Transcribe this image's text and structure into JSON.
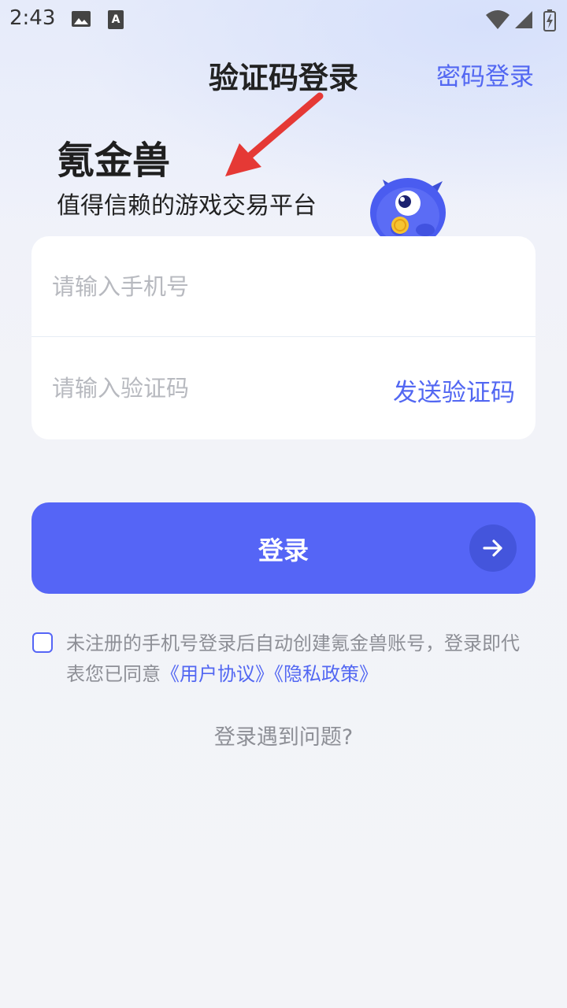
{
  "status_bar": {
    "time": "2:43",
    "icons": [
      "image-icon",
      "text-recognition-icon",
      "wifi-icon",
      "signal-icon",
      "battery-icon"
    ]
  },
  "header": {
    "title": "验证码登录",
    "switch_mode": "密码登录"
  },
  "brand": {
    "name": "氪金兽",
    "slogan": "值得信赖的游戏交易平台"
  },
  "form": {
    "phone_placeholder": "请输入手机号",
    "phone_value": "",
    "code_placeholder": "请输入验证码",
    "code_value": "",
    "send_code": "发送验证码"
  },
  "login": {
    "label": "登录"
  },
  "agreement": {
    "checked": false,
    "text": "未注册的手机号登录后自动创建氪金兽账号，登录即代表您已同意",
    "user_agreement": "《用户协议》",
    "privacy_policy": "《隐私政策》"
  },
  "help": "登录遇到问题?",
  "colors": {
    "accent": "#5565f6",
    "link": "#5267f2",
    "annotation_arrow": "#e53935",
    "background": "#f3f4f8"
  }
}
